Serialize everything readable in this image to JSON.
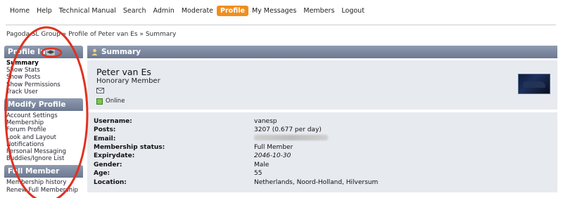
{
  "nav": {
    "items": [
      "Home",
      "Help",
      "Technical Manual",
      "Search",
      "Admin",
      "Moderate",
      "Profile",
      "My Messages",
      "Members",
      "Logout"
    ],
    "active_index": 6
  },
  "breadcrumb": {
    "parts": [
      "Pagoda SL Group",
      "Profile of Peter van Es",
      "Summary"
    ],
    "separator": "»"
  },
  "sidebar": {
    "sections": [
      {
        "title": "Profile Info",
        "items": [
          "Summary",
          "Show Stats",
          "Show Posts",
          "Show Permissions",
          "Track User"
        ]
      },
      {
        "title": "Modify Profile",
        "items": [
          "Account Settings",
          "Membership",
          "Forum Profile",
          "Look and Layout",
          "Notifications",
          "Personal Messaging",
          "Buddies/Ignore List"
        ]
      },
      {
        "title": "Full Member",
        "items": [
          "Membership history",
          "Renew Full Membership"
        ]
      }
    ],
    "current_item": "Summary"
  },
  "main": {
    "header": "Summary",
    "profile": {
      "name": "Peter van Es",
      "role": "Honorary Member",
      "status": "Online"
    },
    "details": {
      "username_label": "Username:",
      "username": "vanesp",
      "posts_label": "Posts:",
      "posts": "3207 (0.677 per day)",
      "email_label": "Email:",
      "membership_label": "Membership status:",
      "membership": "Full Member",
      "expiry_label": "Expirydate:",
      "expiry": "2046-10-30",
      "gender_label": "Gender:",
      "gender": "Male",
      "age_label": "Age:",
      "age": "55",
      "location_label": "Location:",
      "location": "Netherlands, Noord-Holland, Hilversum"
    }
  },
  "colors": {
    "accent": "#ef8e1f",
    "header_bar": "#7b879d",
    "panel_bg": "#e7eaef",
    "annotation": "#e0311f",
    "online": "#7ac943"
  }
}
